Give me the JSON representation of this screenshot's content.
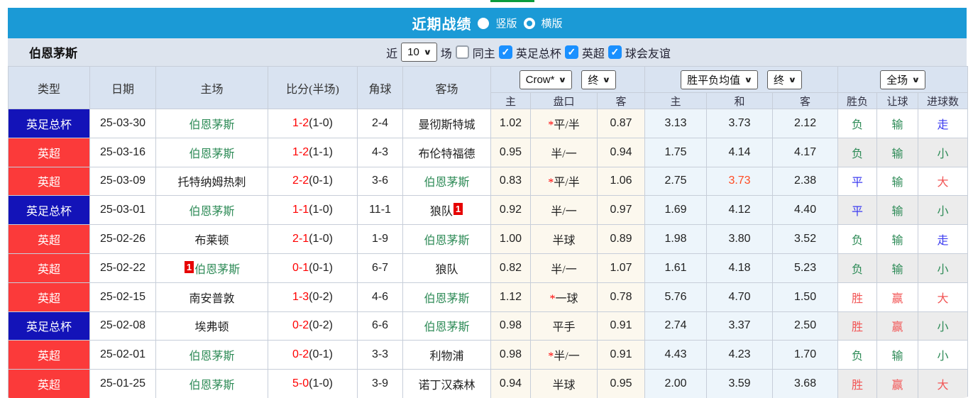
{
  "colors": {
    "accent_blue": "#1b9ad6",
    "league_cup_blue": "#1313b8",
    "league_epl_red": "#fb3a3a",
    "focus_team_green": "#2e8b57",
    "win_red": "#f25555",
    "draw_blue": "#3b3bf0",
    "lose_green": "#2e8b57",
    "score_red": "#ff0000",
    "highlight_orange": "#ff4a22"
  },
  "titlebar": {
    "title": "近期战绩",
    "radio_vertical": "竖版",
    "radio_horizontal": "横版"
  },
  "filterbar": {
    "team": "伯恩茅斯",
    "near_label": "近",
    "games_value": "10",
    "games_suffix": "场",
    "same_home_label": "同主",
    "comp1": "英足总杯",
    "comp2": "英超",
    "comp3": "球会友谊"
  },
  "table": {
    "col_headers": {
      "league": "类型",
      "date": "日期",
      "home": "主场",
      "score": "比分(半场)",
      "corners": "角球",
      "away": "客场"
    },
    "selects": {
      "company": "Crow*",
      "company_time": "终",
      "avg": "胜平负均值",
      "avg_time": "终",
      "scope": "全场"
    },
    "subheaders": [
      "主",
      "盘口",
      "客",
      "主",
      "和",
      "客",
      "胜负",
      "让球",
      "进球数"
    ],
    "rows": [
      {
        "league": "英足总杯",
        "league_color": "blue",
        "date": "25-03-30",
        "home": {
          "name": "伯恩茅斯",
          "green": true,
          "badge": ""
        },
        "score_main": "1-2",
        "score_half": "(1-0)",
        "corners": "2-4",
        "away": {
          "name": "曼彻斯特城",
          "green": false,
          "badge": ""
        },
        "odds": {
          "home": "1.02",
          "handicap": "平/半",
          "star": true,
          "away": "0.87"
        },
        "avg": {
          "home": "3.13",
          "draw": "3.73",
          "draw_highlight": false,
          "away": "2.12"
        },
        "outcome": {
          "result": "负",
          "result_color": "green",
          "handicap": "输",
          "handicap_color": "green",
          "goals": "走",
          "goals_color": "blue"
        },
        "shaded": false
      },
      {
        "league": "英超",
        "league_color": "red",
        "date": "25-03-16",
        "home": {
          "name": "伯恩茅斯",
          "green": true,
          "badge": ""
        },
        "score_main": "1-2",
        "score_half": "(1-1)",
        "corners": "4-3",
        "away": {
          "name": "布伦特福德",
          "green": false,
          "badge": ""
        },
        "odds": {
          "home": "0.95",
          "handicap": "半/一",
          "star": false,
          "away": "0.94"
        },
        "avg": {
          "home": "1.75",
          "draw": "4.14",
          "draw_highlight": false,
          "away": "4.17"
        },
        "outcome": {
          "result": "负",
          "result_color": "green",
          "handicap": "输",
          "handicap_color": "green",
          "goals": "小",
          "goals_color": "green"
        },
        "shaded": true
      },
      {
        "league": "英超",
        "league_color": "red",
        "date": "25-03-09",
        "home": {
          "name": "托特纳姆热刺",
          "green": false,
          "badge": ""
        },
        "score_main": "2-2",
        "score_half": "(0-1)",
        "corners": "3-6",
        "away": {
          "name": "伯恩茅斯",
          "green": true,
          "badge": ""
        },
        "odds": {
          "home": "0.83",
          "handicap": "平/半",
          "star": true,
          "away": "1.06"
        },
        "avg": {
          "home": "2.75",
          "draw": "3.73",
          "draw_highlight": true,
          "away": "2.38"
        },
        "outcome": {
          "result": "平",
          "result_color": "blue",
          "handicap": "输",
          "handicap_color": "green",
          "goals": "大",
          "goals_color": "red"
        },
        "shaded": false
      },
      {
        "league": "英足总杯",
        "league_color": "blue",
        "date": "25-03-01",
        "home": {
          "name": "伯恩茅斯",
          "green": true,
          "badge": ""
        },
        "score_main": "1-1",
        "score_half": "(1-0)",
        "corners": "11-1",
        "away": {
          "name": "狼队",
          "green": false,
          "badge": "1"
        },
        "odds": {
          "home": "0.92",
          "handicap": "半/一",
          "star": false,
          "away": "0.97"
        },
        "avg": {
          "home": "1.69",
          "draw": "4.12",
          "draw_highlight": false,
          "away": "4.40"
        },
        "outcome": {
          "result": "平",
          "result_color": "blue",
          "handicap": "输",
          "handicap_color": "green",
          "goals": "小",
          "goals_color": "green"
        },
        "shaded": true
      },
      {
        "league": "英超",
        "league_color": "red",
        "date": "25-02-26",
        "home": {
          "name": "布莱顿",
          "green": false,
          "badge": ""
        },
        "score_main": "2-1",
        "score_half": "(1-0)",
        "corners": "1-9",
        "away": {
          "name": "伯恩茅斯",
          "green": true,
          "badge": ""
        },
        "odds": {
          "home": "1.00",
          "handicap": "半球",
          "star": false,
          "away": "0.89"
        },
        "avg": {
          "home": "1.98",
          "draw": "3.80",
          "draw_highlight": false,
          "away": "3.52"
        },
        "outcome": {
          "result": "负",
          "result_color": "green",
          "handicap": "输",
          "handicap_color": "green",
          "goals": "走",
          "goals_color": "blue"
        },
        "shaded": false
      },
      {
        "league": "英超",
        "league_color": "red",
        "date": "25-02-22",
        "home": {
          "name": "伯恩茅斯",
          "green": true,
          "badge": "1"
        },
        "score_main": "0-1",
        "score_half": "(0-1)",
        "corners": "6-7",
        "away": {
          "name": "狼队",
          "green": false,
          "badge": ""
        },
        "odds": {
          "home": "0.82",
          "handicap": "半/一",
          "star": false,
          "away": "1.07"
        },
        "avg": {
          "home": "1.61",
          "draw": "4.18",
          "draw_highlight": false,
          "away": "5.23"
        },
        "outcome": {
          "result": "负",
          "result_color": "green",
          "handicap": "输",
          "handicap_color": "green",
          "goals": "小",
          "goals_color": "green"
        },
        "shaded": true
      },
      {
        "league": "英超",
        "league_color": "red",
        "date": "25-02-15",
        "home": {
          "name": "南安普敦",
          "green": false,
          "badge": ""
        },
        "score_main": "1-3",
        "score_half": "(0-2)",
        "corners": "4-6",
        "away": {
          "name": "伯恩茅斯",
          "green": true,
          "badge": ""
        },
        "odds": {
          "home": "1.12",
          "handicap": "一球",
          "star": true,
          "away": "0.78"
        },
        "avg": {
          "home": "5.76",
          "draw": "4.70",
          "draw_highlight": false,
          "away": "1.50"
        },
        "outcome": {
          "result": "胜",
          "result_color": "red",
          "handicap": "赢",
          "handicap_color": "red",
          "goals": "大",
          "goals_color": "red"
        },
        "shaded": false
      },
      {
        "league": "英足总杯",
        "league_color": "blue",
        "date": "25-02-08",
        "home": {
          "name": "埃弗顿",
          "green": false,
          "badge": ""
        },
        "score_main": "0-2",
        "score_half": "(0-2)",
        "corners": "6-6",
        "away": {
          "name": "伯恩茅斯",
          "green": true,
          "badge": ""
        },
        "odds": {
          "home": "0.98",
          "handicap": "平手",
          "star": false,
          "away": "0.91"
        },
        "avg": {
          "home": "2.74",
          "draw": "3.37",
          "draw_highlight": false,
          "away": "2.50"
        },
        "outcome": {
          "result": "胜",
          "result_color": "red",
          "handicap": "赢",
          "handicap_color": "red",
          "goals": "小",
          "goals_color": "green"
        },
        "shaded": true
      },
      {
        "league": "英超",
        "league_color": "red",
        "date": "25-02-01",
        "home": {
          "name": "伯恩茅斯",
          "green": true,
          "badge": ""
        },
        "score_main": "0-2",
        "score_half": "(0-1)",
        "corners": "3-3",
        "away": {
          "name": "利物浦",
          "green": false,
          "badge": ""
        },
        "odds": {
          "home": "0.98",
          "handicap": "半/一",
          "star": true,
          "away": "0.91"
        },
        "avg": {
          "home": "4.43",
          "draw": "4.23",
          "draw_highlight": false,
          "away": "1.70"
        },
        "outcome": {
          "result": "负",
          "result_color": "green",
          "handicap": "输",
          "handicap_color": "green",
          "goals": "小",
          "goals_color": "green"
        },
        "shaded": false
      },
      {
        "league": "英超",
        "league_color": "red",
        "date": "25-01-25",
        "home": {
          "name": "伯恩茅斯",
          "green": true,
          "badge": ""
        },
        "score_main": "5-0",
        "score_half": "(1-0)",
        "corners": "3-9",
        "away": {
          "name": "诺丁汉森林",
          "green": false,
          "badge": ""
        },
        "odds": {
          "home": "0.94",
          "handicap": "半球",
          "star": false,
          "away": "0.95"
        },
        "avg": {
          "home": "2.00",
          "draw": "3.59",
          "draw_highlight": false,
          "away": "3.68"
        },
        "outcome": {
          "result": "胜",
          "result_color": "red",
          "handicap": "赢",
          "handicap_color": "red",
          "goals": "大",
          "goals_color": "red"
        },
        "shaded": true
      }
    ]
  }
}
